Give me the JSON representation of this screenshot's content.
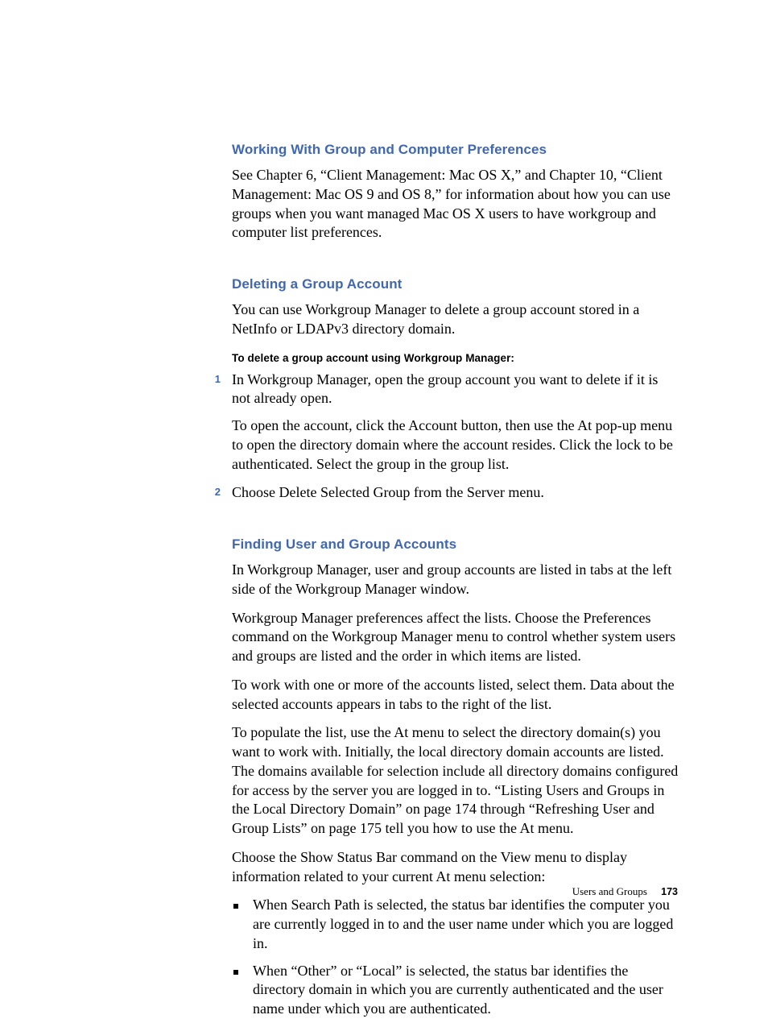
{
  "sections": {
    "s1": {
      "heading": "Working With Group and Computer Preferences",
      "p1": "See Chapter 6, “Client Management: Mac OS X,” and Chapter 10, “Client Management: Mac OS 9 and OS 8,” for information about how you can use groups when you want managed Mac OS X users to have workgroup and computer list preferences."
    },
    "s2": {
      "heading": "Deleting a Group Account",
      "p1": "You can use Workgroup Manager to delete a group account stored in a NetInfo or LDAPv3 directory domain.",
      "subhead": "To delete a group account using Workgroup Manager:",
      "steps": [
        {
          "num": "1",
          "text": "In Workgroup Manager, open the group account you want to delete if it is not already open.",
          "subtext": "To open the account, click the Account button, then use the At pop-up menu to open the directory domain where the account resides. Click the lock to be authenticated. Select the group in the group list."
        },
        {
          "num": "2",
          "text": "Choose Delete Selected Group from the Server menu."
        }
      ]
    },
    "s3": {
      "heading": "Finding User and Group Accounts",
      "p1": "In Workgroup Manager, user and group accounts are listed in tabs at the left side of the Workgroup Manager window.",
      "p2": "Workgroup Manager preferences affect the lists. Choose the Preferences command on the Workgroup Manager menu to control whether system users and groups are listed and the order in which items are listed.",
      "p3": "To work with one or more of the accounts listed, select them. Data about the selected accounts appears in tabs to the right of the list.",
      "p4": "To populate the list, use the At menu to select the directory domain(s) you want to work with. Initially, the local directory domain accounts are listed. The domains available for selection include all directory domains configured for access by the server you are logged in to. “Listing Users and Groups in the Local Directory Domain” on page 174 through “Refreshing User and Group Lists” on page 175 tell you how to use the At menu.",
      "p5": "Choose the Show Status Bar command on the View menu to display information related to your current At menu selection:",
      "bullets": [
        "When Search Path is selected, the status bar identifies the computer you are currently logged in to and the user name under which you are logged in.",
        "When “Other” or “Local” is selected, the status bar identifies the directory domain in which you are currently authenticated and the user name under which you are authenticated."
      ]
    }
  },
  "footer": {
    "chapter": "Users and Groups",
    "page": "173"
  }
}
